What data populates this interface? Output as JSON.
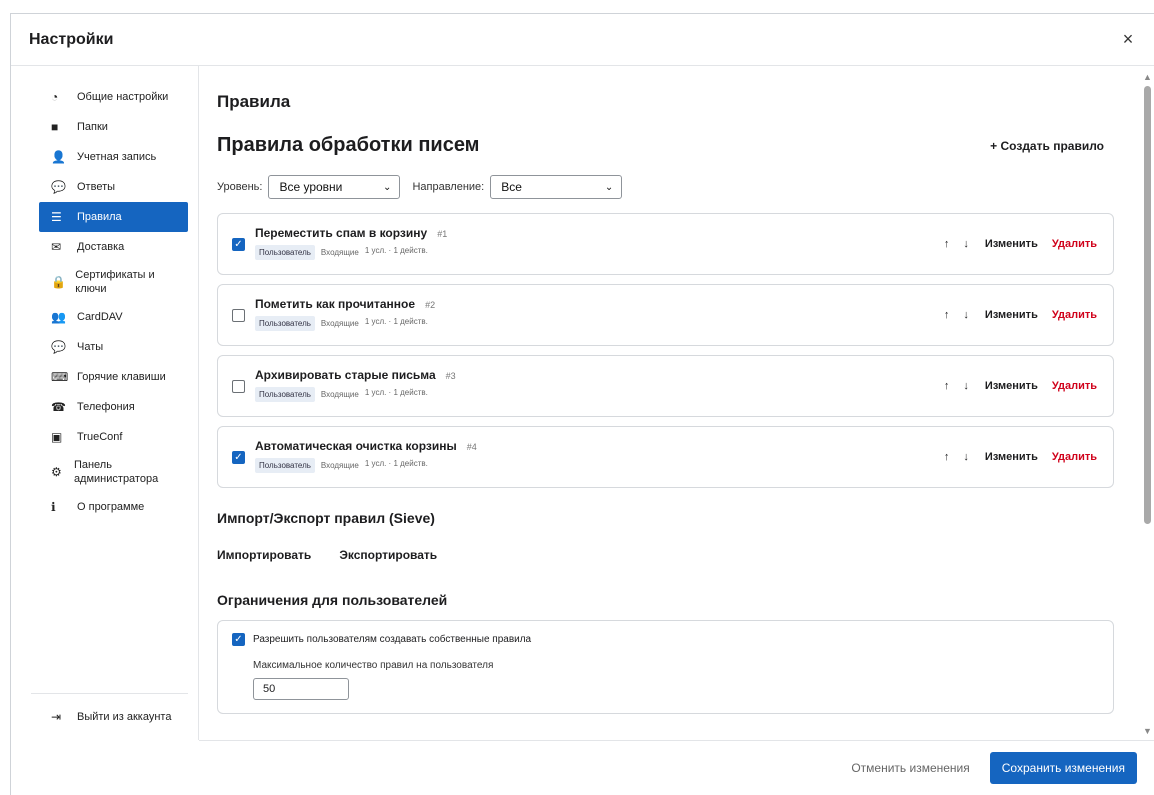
{
  "dialog": {
    "title": "Настройки",
    "close_glyph": "×"
  },
  "sidebar": {
    "items": [
      {
        "label": "Общие настройки",
        "icon": "general-settings-icon",
        "glyph": "◔"
      },
      {
        "label": "Папки",
        "icon": "folder-icon",
        "glyph": "■"
      },
      {
        "label": "Учетная запись",
        "icon": "user-icon",
        "glyph": "👤"
      },
      {
        "label": "Ответы",
        "icon": "replies-icon",
        "glyph": "💬"
      },
      {
        "label": "Правила",
        "icon": "rules-icon",
        "glyph": "☰",
        "active": true
      },
      {
        "label": "Доставка",
        "icon": "envelope-icon",
        "glyph": "✉"
      },
      {
        "label": "Сертификаты и ключи",
        "icon": "lock-icon",
        "glyph": "🔒"
      },
      {
        "label": "CardDAV",
        "icon": "add-user-icon",
        "glyph": "👥"
      },
      {
        "label": "Чаты",
        "icon": "chat-icon",
        "glyph": "💬"
      },
      {
        "label": "Горячие клавиши",
        "icon": "keyboard-icon",
        "glyph": "⌨"
      },
      {
        "label": "Телефония",
        "icon": "phone-icon",
        "glyph": "☎"
      },
      {
        "label": "TrueConf",
        "icon": "video-icon",
        "glyph": "▣"
      },
      {
        "label": "Панель администратора",
        "icon": "admin-icon",
        "glyph": "⚙"
      },
      {
        "label": "О программе",
        "icon": "info-icon",
        "glyph": "ℹ"
      }
    ],
    "logout": {
      "label": "Выйти из аккаунта",
      "icon": "logout-icon",
      "glyph": "⇥"
    }
  },
  "main": {
    "section_title": "Правила",
    "rules_title": "Правила обработки писем",
    "create_label": "+ Создать правило",
    "filters": {
      "level_label": "Уровень:",
      "level_value": "Все уровни",
      "direction_label": "Направление:",
      "direction_value": "Все"
    },
    "rules": [
      {
        "name": "Переместить спам в корзину",
        "num": "#1",
        "checked": true,
        "tag": "Пользователь",
        "direction": "Входящие",
        "counts": "1 усл. · 1 действ."
      },
      {
        "name": "Пометить как прочитанное",
        "num": "#2",
        "checked": false,
        "tag": "Пользователь",
        "direction": "Входящие",
        "counts": "1 усл. · 1 действ."
      },
      {
        "name": "Архивировать старые письма",
        "num": "#3",
        "checked": false,
        "tag": "Пользователь",
        "direction": "Входящие",
        "counts": "1 усл. · 1 действ."
      },
      {
        "name": "Автоматическая очистка корзины",
        "num": "#4",
        "checked": true,
        "tag": "Пользователь",
        "direction": "Входящие",
        "counts": "1 усл. · 1 действ."
      }
    ],
    "rule_actions": {
      "up": "↑",
      "down": "↓",
      "edit": "Изменить",
      "delete": "Удалить"
    },
    "import_export": {
      "title": "Импорт/Экспорт правил (Sieve)",
      "import_label": "Импортировать",
      "export_label": "Экспортировать"
    },
    "limits": {
      "title": "Ограничения для пользователей",
      "allow_label": "Разрешить пользователям создавать собственные правила",
      "allow_checked": true,
      "max_label": "Максимальное количество правил на пользователя",
      "max_value": "50"
    }
  },
  "footer": {
    "cancel_label": "Отменить изменения",
    "save_label": "Сохранить изменения"
  },
  "colors": {
    "accent": "#1565c0",
    "danger": "#d0021b"
  }
}
